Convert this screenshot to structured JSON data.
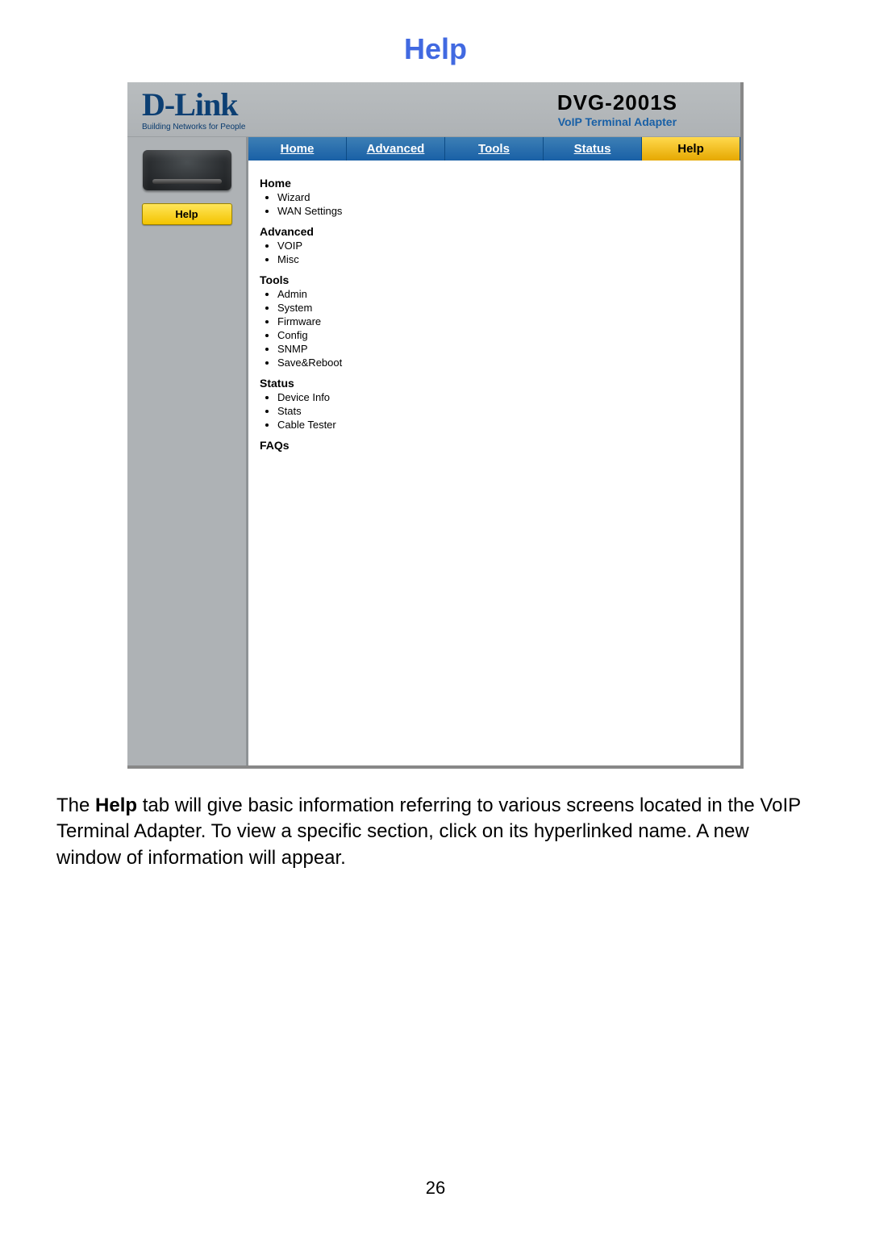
{
  "page": {
    "title": "Help",
    "number": "26"
  },
  "logo": {
    "brand": "D-Link",
    "tagline": "Building Networks for People"
  },
  "product": {
    "model": "DVG-2001S",
    "subtitle": "VoIP Terminal Adapter"
  },
  "sidebar": {
    "help_label": "Help"
  },
  "tabs": {
    "home": "Home",
    "advanced": "Advanced",
    "tools": "Tools",
    "status": "Status",
    "help": "Help"
  },
  "sections": {
    "home": {
      "heading": "Home",
      "items": [
        "Wizard",
        "WAN Settings"
      ]
    },
    "advanced": {
      "heading": "Advanced",
      "items": [
        "VOIP",
        "Misc"
      ]
    },
    "tools": {
      "heading": "Tools",
      "items": [
        "Admin",
        "System",
        "Firmware",
        "Config",
        "SNMP",
        "Save&Reboot"
      ]
    },
    "status": {
      "heading": "Status",
      "items": [
        "Device Info",
        "Stats",
        "Cable Tester"
      ]
    },
    "faqs": "FAQs"
  },
  "caption": {
    "prefix": "The ",
    "bold": "Help",
    "rest": " tab will give basic information referring to various screens located in the VoIP Terminal Adapter. To view a specific section, click on its hyperlinked name. A new window of information will appear."
  }
}
